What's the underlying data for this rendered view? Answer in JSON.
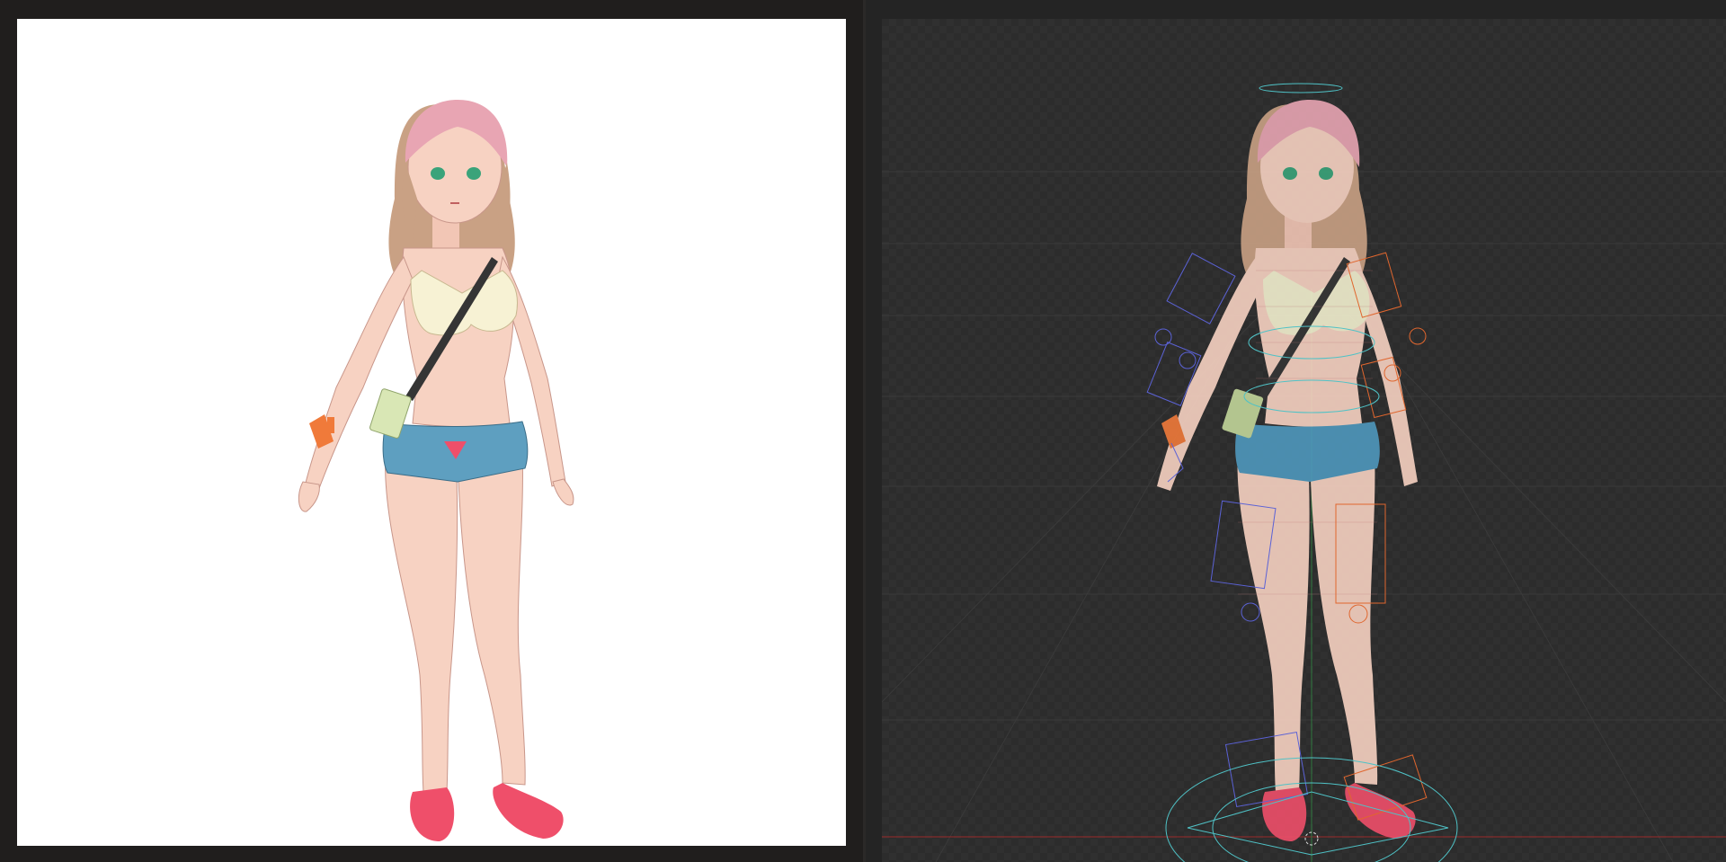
{
  "left_panel": {
    "name": "reference-render"
  },
  "right_panel": {
    "name": "rig-viewport"
  },
  "colors": {
    "frame": "#201e1d",
    "canvas": "#ffffff",
    "viewport": "#2c2c2c",
    "skin": "#f7d2c2",
    "hair_top": "#e8a5b3",
    "hair_bottom": "#c9a184",
    "top": "#f7f2d4",
    "shorts": "#5e9fc0",
    "sandals": "#ef4f6a",
    "strap": "#353535",
    "bag": "#d9e7b5",
    "wristband": "#f07a3a",
    "wire": "#4fc2c6",
    "rig_left": "#5b62d6",
    "rig_right": "#e0662e",
    "ground_axis": "#9b2a2a"
  },
  "icons": {
    "character": "anime-character-figure",
    "rig": "rig-controls-overlay"
  }
}
